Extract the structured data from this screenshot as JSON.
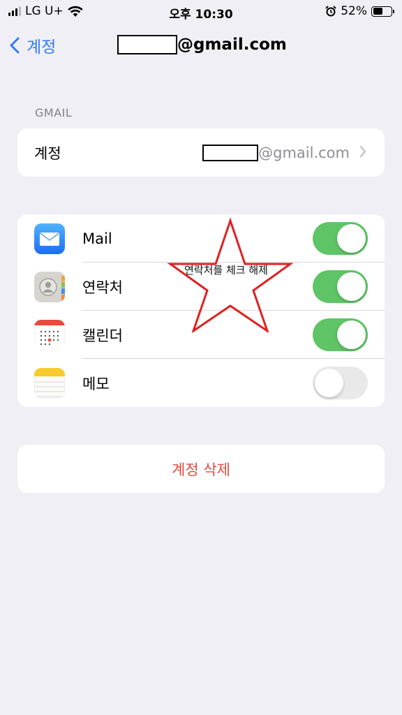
{
  "status_bar": {
    "carrier": "LG U+",
    "time": "오후 10:30",
    "battery_percent": "52%",
    "battery_level": 0.52,
    "signal_bars_active": 3,
    "signal_bars_total": 4
  },
  "nav": {
    "back_label": "계정",
    "title_suffix": "@gmail.com"
  },
  "section": {
    "header": "GMAIL"
  },
  "account_row": {
    "label": "계정",
    "value_suffix": "@gmail.com"
  },
  "apps": [
    {
      "label": "Mail",
      "icon": "mail-icon",
      "enabled": true
    },
    {
      "label": "연락처",
      "icon": "contacts-icon",
      "enabled": true
    },
    {
      "label": "캘린더",
      "icon": "calendar-icon",
      "enabled": true
    },
    {
      "label": "메모",
      "icon": "notes-icon",
      "enabled": false
    }
  ],
  "delete_account_label": "계정 삭제",
  "annotation": {
    "text": "연락처를 체크 해제",
    "color": "#e02020"
  },
  "colors": {
    "accent_blue": "#2f7cf6",
    "toggle_on": "#5fc466",
    "destructive_red": "#e4493e",
    "background": "#f0eff5"
  }
}
